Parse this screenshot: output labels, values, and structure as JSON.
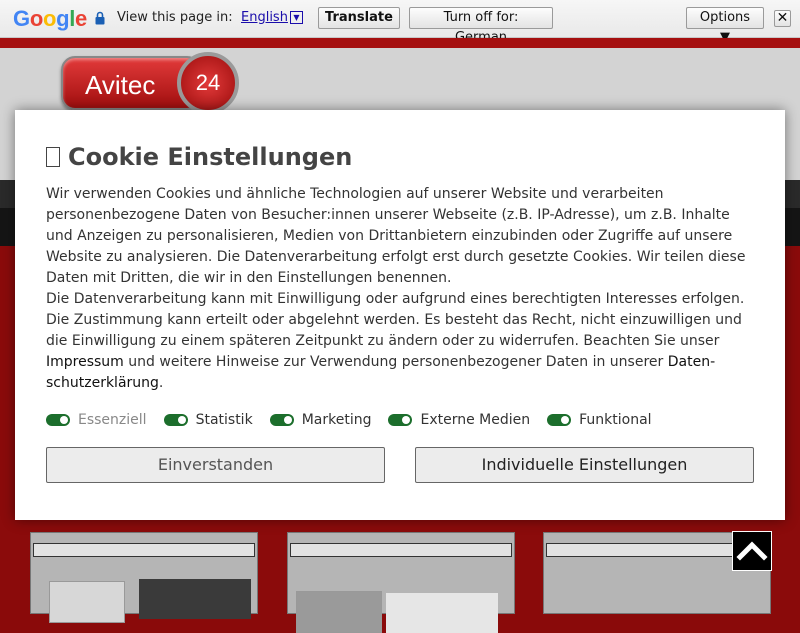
{
  "translate_bar": {
    "logo": {
      "letters": [
        "G",
        "o",
        "o",
        "g",
        "l",
        "e"
      ],
      "colors": [
        "#4285f4",
        "#ea4335",
        "#fbbc05",
        "#4285f4",
        "#34a853",
        "#ea4335"
      ]
    },
    "lock_icon": "lock-icon",
    "view_text": "View this page in:",
    "language": "English",
    "dropdown_glyph": "▼",
    "translate_label": "Translate",
    "turn_off_label": "Turn off for: German",
    "options_label": "Options ▼",
    "close_label": "✕"
  },
  "site": {
    "logo_text": "Avitec",
    "logo_number": "24",
    "accent_color": "#a50f0f"
  },
  "cookie_modal": {
    "title": "Cookie Einstellungen",
    "paragraph1": "Wir verwenden Cookies und ähnliche Technologien auf unserer Website und verarbeiten personenbezogene Daten von Besucher:innen unserer Webseite (z.B. IP-Adresse), um z.B. Inhalte und Anzeigen zu personalisieren, Medien von Drittanbietern einzubinden oder Zugriffe auf unsere Website zu analysieren. Die Datenverarbeitung erfolgt erst durch gesetzte Cookies. Wir teilen diese Daten mit Dritten, die wir in den Einstellungen benennen.",
    "paragraph2_before": "Die Datenverarbeitung kann mit Einwilligung oder aufgrund eines berechtigten Interesses erfolgen. Die Zustimmung kann erteilt oder abgelehnt werden. Es besteht das Recht, nicht einzuwilligen und die Einwilligung zu einem späteren Zeitpunkt zu ändern oder zu widerrufen. Beachten Sie unser",
    "impressum_link": "Impressum",
    "paragraph2_middle": "und weitere Hinweise zur Verwendung personenbezogener Daten in unserer",
    "privacy_link": "Daten­schutzerklärung",
    "paragraph2_end": ".",
    "toggles": [
      {
        "label": "Essenziell",
        "on": true,
        "disabled": true
      },
      {
        "label": "Statistik",
        "on": true,
        "disabled": false
      },
      {
        "label": "Marketing",
        "on": true,
        "disabled": false
      },
      {
        "label": "Externe Medien",
        "on": true,
        "disabled": false
      },
      {
        "label": "Funktional",
        "on": true,
        "disabled": false
      }
    ],
    "accept_label": "Einverstanden",
    "individual_label": "Individuelle Einstellungen"
  },
  "scroll_top_icon": "chevron-up-icon"
}
